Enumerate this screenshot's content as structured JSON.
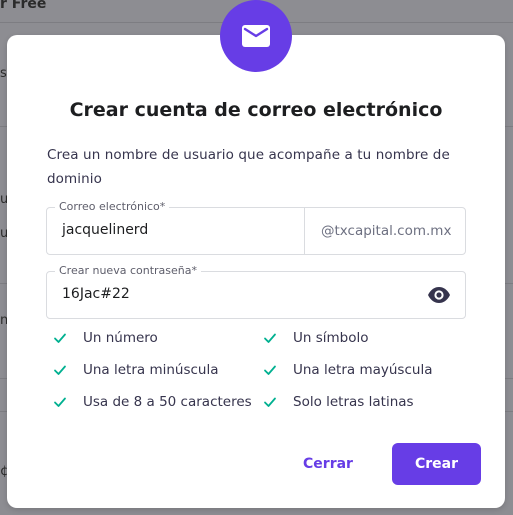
{
  "background": {
    "header_fragment": "r Free",
    "fragments": [
      "s",
      "u",
      "u",
      "n",
      "¢"
    ]
  },
  "modal": {
    "icon": "envelope-icon",
    "title": "Crear cuenta de correo electrónico",
    "description": "Crea un nombre de usuario que acompañe a tu nombre de dominio",
    "email_field": {
      "label": "Correo electrónico*",
      "value": "jacquelinerd",
      "domain_suffix": "@txcapital.com.mx"
    },
    "password_field": {
      "label": "Crear nueva contraseña*",
      "value": "16Jac#22",
      "toggle_icon": "eye-icon"
    },
    "requirements": [
      {
        "label": "Un número",
        "met": true
      },
      {
        "label": "Un símbolo",
        "met": true
      },
      {
        "label": "Una letra minúscula",
        "met": true
      },
      {
        "label": "Una letra mayúscula",
        "met": true
      },
      {
        "label": "Usa de 8 a 50 caracteres",
        "met": true
      },
      {
        "label": "Solo letras latinas",
        "met": true
      }
    ],
    "buttons": {
      "close_label": "Cerrar",
      "create_label": "Crear"
    }
  },
  "colors": {
    "accent": "#673de6",
    "check": "#00b090",
    "overlay": "#8d8d92"
  }
}
